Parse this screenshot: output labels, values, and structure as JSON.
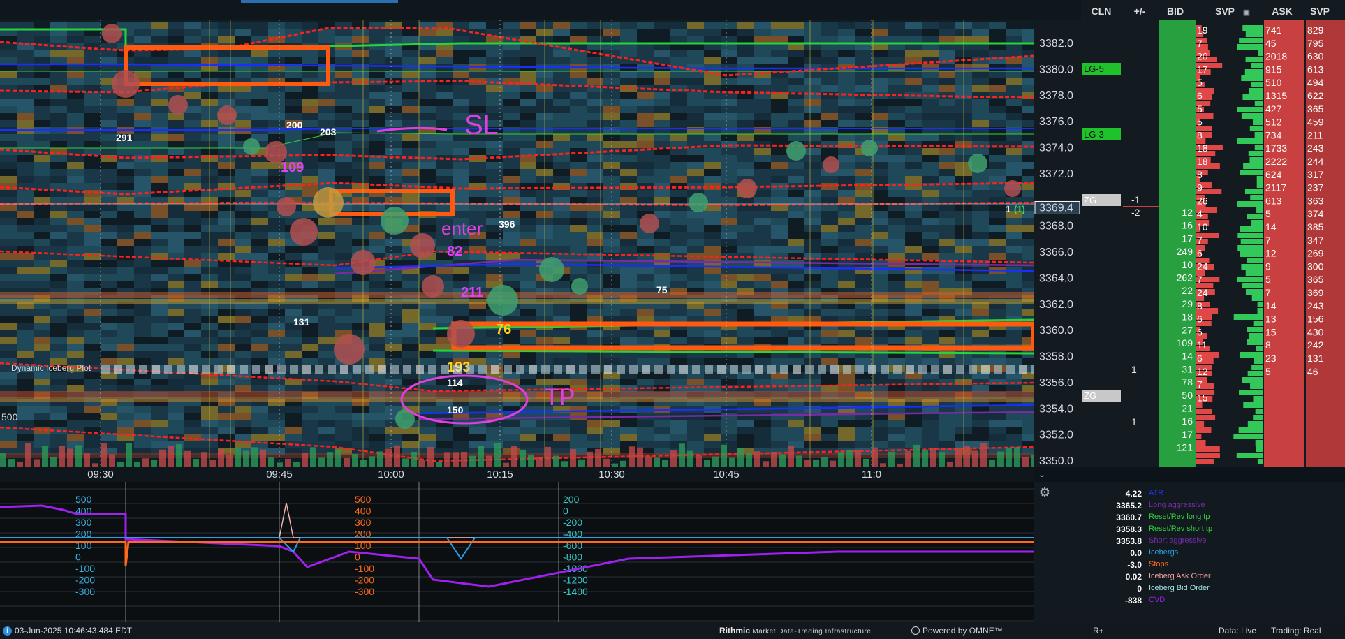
{
  "chart": {
    "price_ticks": [
      "3382.0",
      "3380.0",
      "3378.0",
      "3376.0",
      "3374.0",
      "3372.0",
      "3369.4",
      "3368.0",
      "3366.0",
      "3364.0",
      "3362.0",
      "3360.0",
      "3358.0",
      "3356.0",
      "3354.0",
      "3352.0",
      "3350.0"
    ],
    "current_price": "3369.4",
    "time_ticks": [
      "09:30",
      "09:45",
      "10:00",
      "10:15",
      "10:30",
      "10:45",
      "11:0"
    ],
    "dynamic_iceberg_label": "Dynamic Iceberg Plot",
    "left_axis_label": "500",
    "bubble_labels": [
      "291",
      "200",
      "203",
      "109",
      "396",
      "82",
      "211",
      "75",
      "131",
      "76",
      "193",
      "114",
      "150"
    ],
    "annotations": [
      "SL",
      "enter",
      "TP"
    ],
    "right_markers": [
      "1",
      "(1)"
    ]
  },
  "ladder": {
    "headers": [
      "CLN",
      "+/-",
      "BID",
      "SVP",
      "ASK",
      "SVP"
    ],
    "svp_header_icon": "calendar-icon",
    "levels": [
      "LG-5",
      "LG-3",
      "ZG",
      "ZG"
    ],
    "plusminus": [
      "-1",
      "-2",
      "1",
      "1"
    ],
    "bid_values": [
      "12",
      "16",
      "17",
      "249",
      "10",
      "262",
      "22",
      "29",
      "18",
      "27",
      "109",
      "14",
      "31",
      "78",
      "50",
      "21",
      "16",
      "17",
      "121"
    ],
    "svp_left": [
      "19",
      "7",
      "20",
      "17",
      "5",
      "6",
      "5",
      "5",
      "8",
      "18",
      "18",
      "8",
      "9",
      "26",
      "4",
      "10",
      "7",
      "6",
      "24",
      "7",
      "24",
      "8",
      "6",
      "6",
      "11",
      "6",
      "12",
      "7",
      "15"
    ],
    "ask_values": [
      "741",
      "45",
      "2018",
      "915",
      "510",
      "1315",
      "427",
      "512",
      "734",
      "1733",
      "2222",
      "624",
      "2117",
      "613",
      "5",
      "14",
      "7",
      "12",
      "9",
      "5",
      "7",
      "14",
      "13",
      "15",
      "8",
      "23",
      "5"
    ],
    "svp_right": [
      "829",
      "795",
      "630",
      "613",
      "494",
      "622",
      "365",
      "459",
      "211",
      "243",
      "244",
      "317",
      "237",
      "363",
      "374",
      "385",
      "347",
      "269",
      "300",
      "365",
      "369",
      "243",
      "156",
      "430",
      "242",
      "131",
      "46"
    ]
  },
  "lower": {
    "axis_cyan": [
      "500",
      "400",
      "300",
      "200",
      "100",
      "0",
      "-100",
      "-200",
      "-300"
    ],
    "axis_orange": [
      "500",
      "400",
      "300",
      "200",
      "100",
      "0",
      "-100",
      "-200",
      "-300"
    ],
    "axis_teal": [
      "200",
      "0",
      "-200",
      "-400",
      "-600",
      "-800",
      "-1000",
      "-1200",
      "-1400"
    ]
  },
  "legend": [
    {
      "value": "4.22",
      "name": "ATR",
      "color": "#2233ff"
    },
    {
      "value": "3365.2",
      "name": "Long aggressive",
      "color": "#7a2aa8"
    },
    {
      "value": "3360.7",
      "name": "Reset/Rev long tp",
      "color": "#32d23a"
    },
    {
      "value": "3358.3",
      "name": "Reset/Rev short tp",
      "color": "#32d23a"
    },
    {
      "value": "3353.8",
      "name": "Short aggressive",
      "color": "#7a2aa8"
    },
    {
      "value": "0.0",
      "name": "Icebergs",
      "color": "#2aa0e6"
    },
    {
      "value": "-3.0",
      "name": "Stops",
      "color": "#ff6a1a"
    },
    {
      "value": "0.02",
      "name": "Iceberg Ask Order",
      "color": "#f0a0a0"
    },
    {
      "value": "0",
      "name": "Iceberg Bid Order",
      "color": "#a0e0e0"
    },
    {
      "value": "-838",
      "name": "CVD",
      "color": "#a020f0"
    }
  ],
  "status": {
    "datetime": "03-Jun-2025 10:46:43.484 EDT",
    "rithmic": "Rithmic",
    "rithmic_sub": "Market Data-Trading Infrastructure",
    "omne": "Powered by OMNE™",
    "r_plus": "R+",
    "data": "Data: Live",
    "trading": "Trading: Real"
  }
}
